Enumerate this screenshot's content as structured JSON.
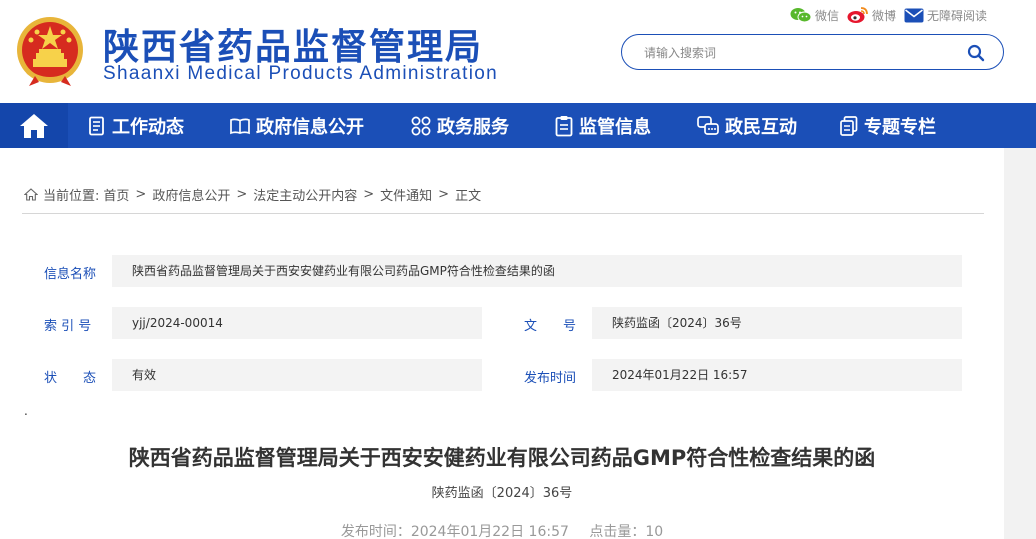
{
  "header": {
    "title_cn": "陕西省药品监督管理局",
    "title_en": "Shaanxi Medical Products Administration",
    "social": {
      "wechat": "微信",
      "weibo": "微博",
      "accessible": "无障碍阅读"
    },
    "search": {
      "placeholder": "请输入搜索词"
    }
  },
  "nav": {
    "items": [
      {
        "label": "工作动态",
        "icon": "document-list-icon"
      },
      {
        "label": "政府信息公开",
        "icon": "book-icon"
      },
      {
        "label": "政务服务",
        "icon": "grid-icon"
      },
      {
        "label": "监管信息",
        "icon": "clipboard-icon"
      },
      {
        "label": "政民互动",
        "icon": "chat-icon"
      },
      {
        "label": "专题专栏",
        "icon": "file-copy-icon"
      }
    ]
  },
  "breadcrumb": {
    "prefix": "当前位置:",
    "items": [
      "首页",
      "政府信息公开",
      "法定主动公开内容",
      "文件通知",
      "正文"
    ]
  },
  "meta": {
    "name_label": "信息名称",
    "name_value": "陕西省药品监督管理局关于西安安健药业有限公司药品GMP符合性检查结果的函",
    "index_label": "索 引 号",
    "index_value": "yjj/2024-00014",
    "docno_label": "文　　号",
    "docno_value": "陕药监函〔2024〕36号",
    "status_label": "状　　态",
    "status_value": "有效",
    "date_label": "发布时间",
    "date_value": "2024年01月22日 16:57"
  },
  "stray_dot": ".",
  "document": {
    "title": "陕西省药品监督管理局关于西安安健药业有限公司药品GMP符合性检查结果的函",
    "number": "陕药监函〔2024〕36号",
    "publish_label": "发布时间：2024年01月22日 16:57",
    "views_label": "点击量：",
    "views": "10"
  },
  "colors": {
    "brand_blue": "#1b4fb7",
    "nav_home_blue": "#1446ab"
  }
}
